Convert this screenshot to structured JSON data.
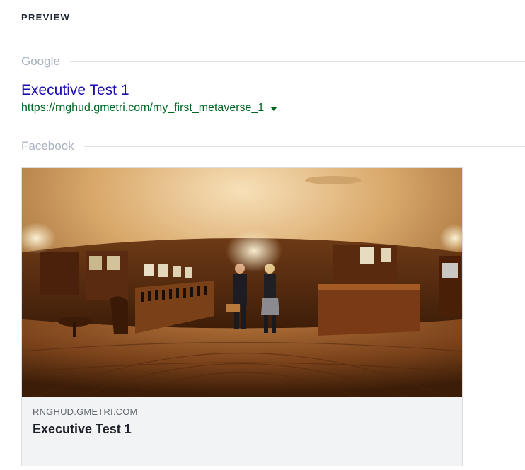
{
  "preview": {
    "heading": "PREVIEW"
  },
  "google": {
    "section_label": "Google",
    "title": "Executive Test 1",
    "url": "https://rnghud.gmetri.com/my_first_metaverse_1",
    "colors": {
      "title": "#1a0dab",
      "url": "#006621"
    }
  },
  "facebook": {
    "section_label": "Facebook",
    "domain": "RNGHUD.GMETRI.COM",
    "title": "Executive Test 1",
    "image_icon": "panoramic-wine-shop-photo"
  }
}
